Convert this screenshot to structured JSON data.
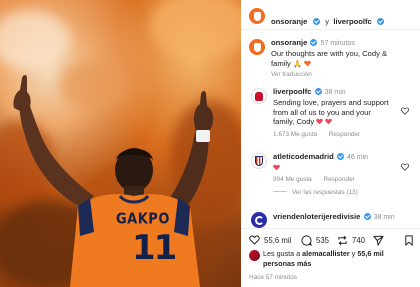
{
  "post": {
    "author": "onsoranje",
    "connector": "y",
    "coauthor": "liverpoolfc",
    "caption_handle": "onsoranje",
    "caption_time": "57 minutos",
    "caption_text": "Our thoughts are with you, Cody & family",
    "translate_link": "Ver traducción",
    "jersey_name": "GAKPO",
    "jersey_number": "11"
  },
  "comments": [
    {
      "handle": "liverpoolfc",
      "time": "38 min",
      "text": "Sending love, prayers and support from all of us to you and your family, Cody",
      "likes": "1.673 Me gusta",
      "reply": "Responder"
    },
    {
      "handle": "atleticodemadrid",
      "time": "46 min",
      "likes": "994 Me gusta",
      "reply": "Responder",
      "view_replies": "Ver las respuestas (13)"
    },
    {
      "handle": "vriendenloterijeredivisie",
      "time": "38 min"
    }
  ],
  "actions": {
    "likes_count": "55,6 mil",
    "comments_count": "535",
    "shares_count": "740"
  },
  "likes_line": {
    "prefix": "Les gusta a",
    "user": "alemacallister",
    "middle": "y",
    "others": "55,6 mil personas más"
  },
  "posted_ago": "Hace 57 minutos",
  "colors": {
    "accent": "#3897f0",
    "heart": "#ed4956",
    "orange": "#f36c21"
  }
}
